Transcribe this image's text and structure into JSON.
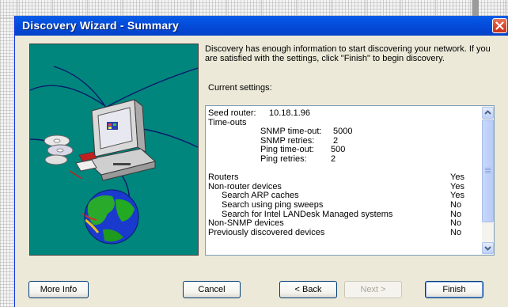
{
  "window": {
    "title": "Discovery Wizard - Summary"
  },
  "description": "Discovery has enough information to start discovering your network.  If you are satisfied with the settings, click \"Finish\" to begin discovery.",
  "current_settings_label": "Current settings:",
  "settings": {
    "seed_router_label": "Seed router:",
    "seed_router_value": "10.18.1.96",
    "timeouts_label": "Time-outs",
    "snmp_timeout_label": "SNMP time-out:",
    "snmp_timeout_value": "5000",
    "snmp_retries_label": "SNMP retries:",
    "snmp_retries_value": "2",
    "ping_timeout_label": "Ping time-out:",
    "ping_timeout_value": "500",
    "ping_retries_label": "Ping retries:",
    "ping_retries_value": "2",
    "items": [
      {
        "label": "Routers",
        "value": "Yes"
      },
      {
        "label": "Non-router devices",
        "value": "Yes"
      },
      {
        "label": "Search ARP caches",
        "value": "Yes"
      },
      {
        "label": "Search using ping sweeps",
        "value": "No"
      },
      {
        "label": "Search for Intel LANDesk Managed systems",
        "value": "No"
      },
      {
        "label": "Non-SNMP devices",
        "value": "No"
      },
      {
        "label": "Previously discovered devices",
        "value": "No"
      }
    ]
  },
  "buttons": {
    "more_info": "More Info",
    "cancel": "Cancel",
    "back": "< Back",
    "next": "Next >",
    "finish": "Finish"
  },
  "icons": [
    "close-icon",
    "scroll-up-icon",
    "scroll-down-icon",
    "computer-icon",
    "cd-icon",
    "globe-icon"
  ],
  "colors": {
    "titlebar": "#0454e0",
    "illustration_bg": "#00867d",
    "dialog_bg": "#ece9d8"
  }
}
